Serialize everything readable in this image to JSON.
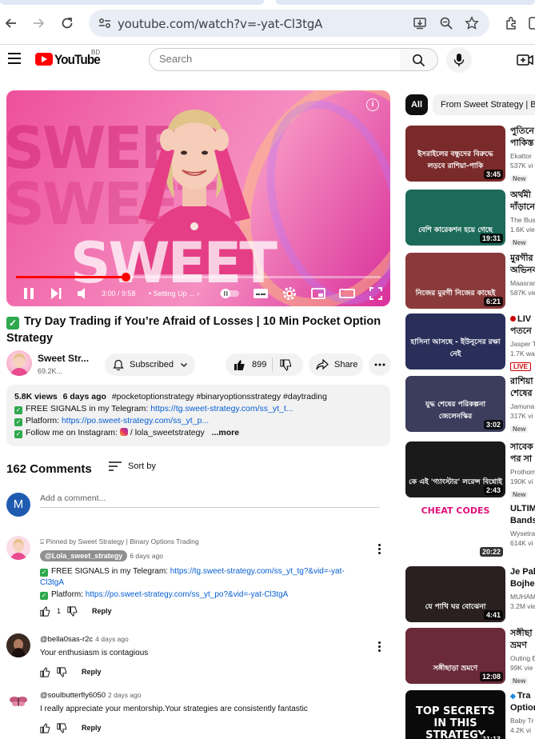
{
  "browser": {
    "url": "youtube.com/watch?v=-yat-Cl3tgA"
  },
  "header": {
    "wordmark": "YouTube",
    "country": "BD",
    "search_placeholder": "Search"
  },
  "player": {
    "time": "3:00 / 9:58",
    "chapter": "• Setting Up ...",
    "chapter_chevron": "›",
    "progress_fraction": 0.301
  },
  "video": {
    "title": "Try Day Trading if You’re Afraid of Losses | 10 Min Pocket Option Strategy",
    "channel_name": "Sweet Str...",
    "subscribers": "69.2K...",
    "subscribed_label": "Subscribed",
    "likes": "899",
    "share_label": "Share"
  },
  "description": {
    "views": "5.8K views",
    "age": "6 days ago",
    "hashtags": "#pocketoptionstrategy #binaryoptionsstrategy #daytrading",
    "line1_text": "FREE SIGNALS in my Telegram: ",
    "line1_link": "https://tg.sweet-strategy.com/ss_yt_t...",
    "line2_text": "Platform: ",
    "line2_link": "https://po.sweet-strategy.com/ss_yt_p...",
    "line3_text": "Follow me on Instagram: ",
    "line3_link": "/ lola_sweetstrategy",
    "more": "...more"
  },
  "comments": {
    "count": "162 Comments",
    "sort_label": "Sort by",
    "my_avatar_letter": "M",
    "add_placeholder": "Add a comment...",
    "reply_label": "Reply",
    "items": [
      {
        "pinned": "Pinned by Sweet Strategy | Binary Options Trading",
        "author": "@Lola_sweet_strategy",
        "time": "6 days ago",
        "line1_text": "FREE SIGNALS in my Telegram: ",
        "line1_link": "https://tg.sweet-strategy.com/ss_yt_tg?&vid=-yat-Cl3tgA",
        "line2_text": "Platform: ",
        "line2_link": "https://po.sweet-strategy.com/ss_yt_po?&vid=-yat-Cl3tgA",
        "likes": "1"
      },
      {
        "author": "@bella0sas-r2c",
        "time": "4 days ago",
        "text": "Your enthusiasm is contagious"
      },
      {
        "author": "@soulbutterfly6050",
        "time": "2 days ago",
        "text": "I really appreciate your mentorship.Your strategies are consistently fantastic"
      }
    ]
  },
  "rail": {
    "chip_all": "All",
    "chip_from": "From Sweet Strategy | Bin",
    "new_label": "New",
    "live_label": "LIVE",
    "items": [
      {
        "title": "পুতিনে",
        "title2": "পাকিস্ত",
        "channel": "Ekattor",
        "views": "537K vi",
        "duration": "3:45",
        "caption": "ইসরাইলের বন্ধুদের বিরুদ্ধে লড়বে রাশিয়া-পাকি",
        "badge": "new",
        "color": "#7a2a2a"
      },
      {
        "title": "অর্থমী",
        "title2": "দাঁড়ানে",
        "channel": "The Bus",
        "views": "1.6K vie",
        "duration": "19:31",
        "caption": "বেশি কারেকশন হয়ে গেছে",
        "badge": "new",
        "color": "#1c6a5a"
      },
      {
        "title": "মুরগীর",
        "title2": "অভিনব",
        "channel": "Maasrar",
        "views": "587K vie",
        "duration": "6:21",
        "caption": "নিজের মুরগী নিজের কাছেই",
        "badge": "",
        "color": "#8a3a3a"
      },
      {
        "title": "LIV",
        "title2": "পতনে",
        "channel": "Jasper T",
        "views": "1.7K wa",
        "duration": "",
        "caption": "হাসিনা আসছে - ইউনূসের রক্ষা নেই",
        "badge": "live",
        "color": "#2a2f5a"
      },
      {
        "title": "রাশিয়া",
        "title2": "শেষের",
        "channel": "Jamuna",
        "views": "317K vi",
        "duration": "3:02",
        "caption": "যুদ্ধ শেষের পরিকল্পনা জেলেনস্কির",
        "badge": "new",
        "color": "#3c3c5c"
      },
      {
        "title": "সাবেক",
        "title2": "পর সা",
        "channel": "Prothom",
        "views": "190K vi",
        "duration": "2:43",
        "caption": "কে এই 'গ্যাংস্টার' লরেন্স বিশ্নোই",
        "badge": "new",
        "color": "#1a1a1a"
      },
      {
        "title": "ULTIM",
        "title2": "Bands",
        "channel": "Wysetra",
        "views": "614K vi",
        "duration": "20:22",
        "caption": "CHEAT CODES",
        "badge": "",
        "color": "#ffffff"
      },
      {
        "title": "Je Pak",
        "title2": "Bojher",
        "channel": "MUHAM",
        "views": "3.2M vie",
        "duration": "4:41",
        "caption": "যে পাখি ঘর বোঝেনা",
        "badge": "",
        "color": "#2a2020"
      },
      {
        "title": "সঙ্গীছা",
        "title2": "ভ্রমণ",
        "channel": "Outing E",
        "views": "99K vie",
        "duration": "12:08",
        "caption": "সঙ্গীছাড়া ভ্রমণে",
        "badge": "new",
        "color": "#6a2a3a"
      },
      {
        "title": "Tra",
        "title2": "Option",
        "channel": "Baby Tr",
        "views": "4.2K vi",
        "duration": "11:13",
        "caption": "TOP SECRETS IN THIS STRATEGY",
        "badge": "",
        "color": "#0a0a0a"
      }
    ]
  }
}
